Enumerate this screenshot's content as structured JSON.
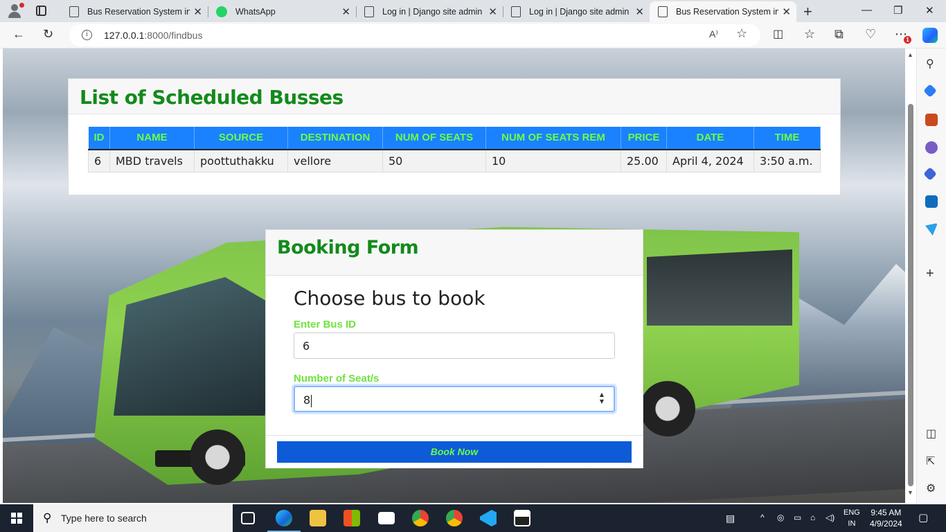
{
  "browser": {
    "tabs": [
      {
        "title": "Bus Reservation System in D",
        "icon": "page-icon",
        "active": false
      },
      {
        "title": "WhatsApp",
        "icon": "whatsapp-icon",
        "active": false
      },
      {
        "title": "Log in | Django site admin",
        "icon": "page-icon",
        "active": false
      },
      {
        "title": "Log in | Django site admin",
        "icon": "page-icon",
        "active": false
      },
      {
        "title": "Bus Reservation System in D",
        "icon": "page-icon",
        "active": true
      }
    ],
    "url_host": "127.0.0.1",
    "url_path": ":8000/findbus",
    "extensions_badge": "1",
    "info_glyph": "i",
    "read_aloud_glyph": "A⁾"
  },
  "schedule": {
    "heading": "List of Scheduled Busses",
    "columns": [
      "ID",
      "NAME",
      "SOURCE",
      "DESTINATION",
      "NUM OF SEATS",
      "NUM OF SEATS REM",
      "PRICE",
      "DATE",
      "TIME"
    ],
    "rows": [
      [
        "6",
        "MBD travels",
        "poottuthakku",
        "vellore",
        "50",
        "10",
        "25.00",
        "April 4, 2024",
        "3:50 a.m."
      ]
    ]
  },
  "booking": {
    "heading": "Booking Form",
    "subheading": "Choose bus to book",
    "bus_id_label": "Enter Bus ID",
    "bus_id_value": "6",
    "seats_label": "Number of Seat/s",
    "seats_value": "8",
    "submit_label": "Book Now"
  },
  "colors": {
    "heading_green": "#138a1c",
    "label_green": "#6fe33e",
    "table_header_bg": "#1a82ff",
    "button_bg": "#0d5bd7"
  },
  "taskbar": {
    "search_placeholder": "Type here to search",
    "apps": [
      "task-view-icon",
      "edge-icon",
      "file-explorer-icon",
      "store-icon",
      "mail-icon",
      "chrome-icon",
      "chrome-profile-icon",
      "vscode-icon",
      "photos-icon"
    ],
    "lang_line1": "ENG",
    "lang_line2": "IN",
    "time": "9:45 AM",
    "date": "4/9/2024"
  }
}
